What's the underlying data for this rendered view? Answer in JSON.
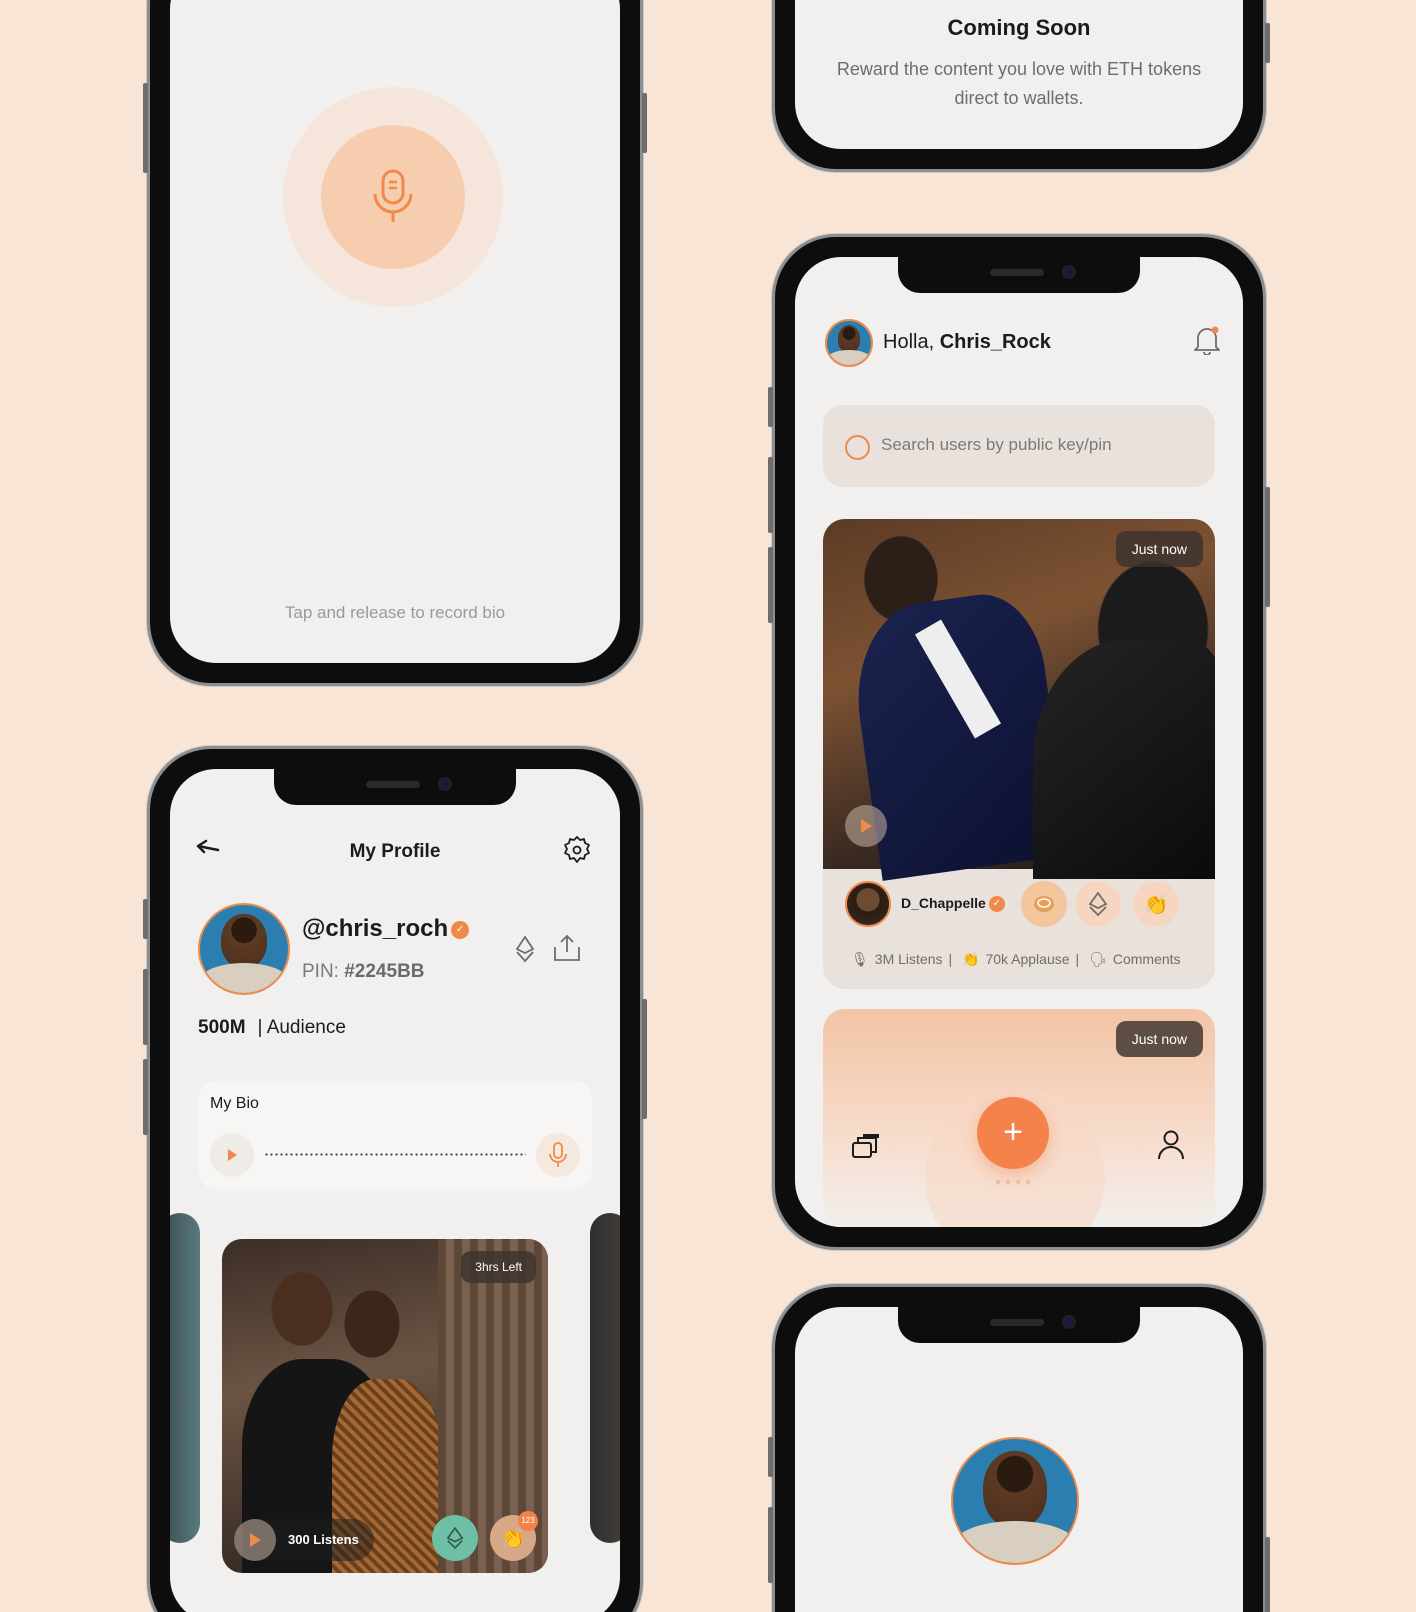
{
  "record_screen": {
    "hint": "Tap and release to record bio"
  },
  "coming_soon": {
    "title": "Coming Soon",
    "text": "Reward the content you love with ETH tokens direct to wallets."
  },
  "home": {
    "greeting_prefix": "Holla, ",
    "username": "Chris_Rock",
    "search_placeholder": "Search users by public key/pin",
    "post": {
      "time": "Just now",
      "author": "D_Chappelle",
      "listens": "3M Listens",
      "applause": "70k Applause",
      "comments": "Comments"
    },
    "draft": {
      "time": "Just now",
      "fab_label": "+"
    }
  },
  "profile": {
    "title": "My Profile",
    "handle": "@chris_roch",
    "pin_label": "PIN: ",
    "pin_value": "#2245BB",
    "audience_count": "500M",
    "audience_label": "| Audience",
    "bio_label": "My Bio",
    "story": {
      "time_left": "3hrs Left",
      "listens": "300 Listens",
      "clap_count": "123"
    }
  },
  "colors": {
    "accent": "#f08a4b",
    "background": "#f9e5d6"
  }
}
